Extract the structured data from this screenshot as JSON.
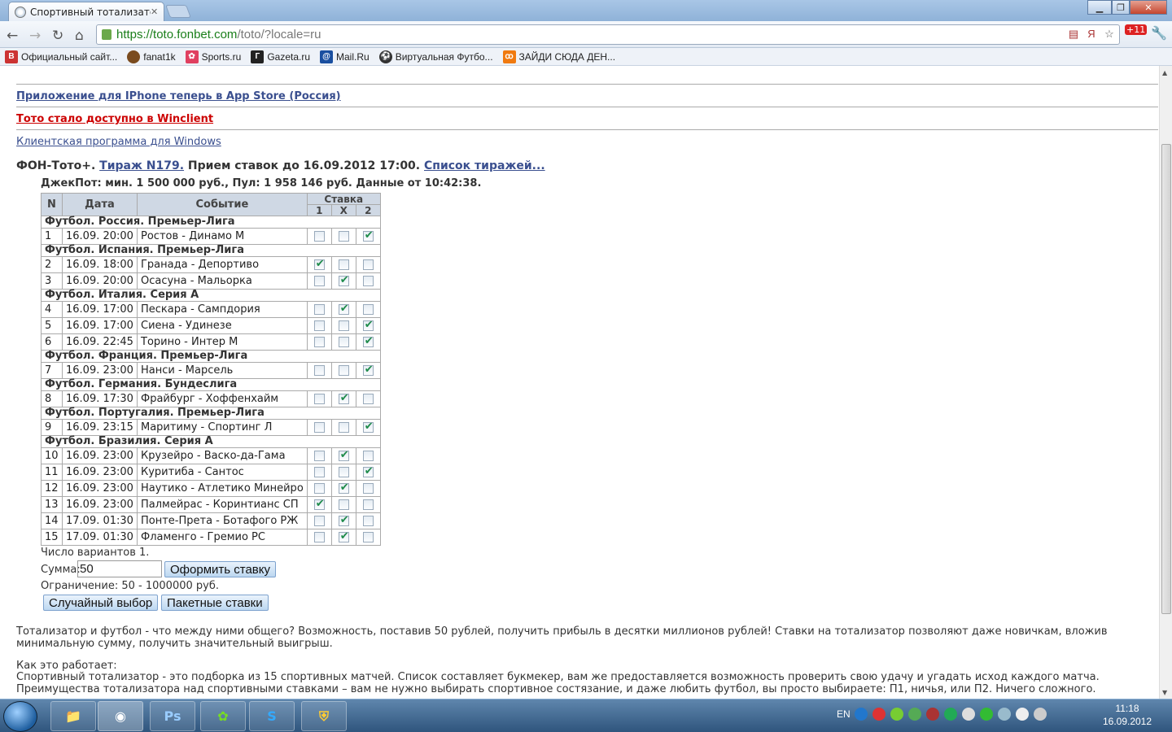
{
  "browser": {
    "tab_title": "Спортивный тотализатор,",
    "url_scheme": "https://",
    "url_host": "toto.fonbet.com",
    "url_rest": "/toto/?locale=ru",
    "bookmarks": [
      "Официальный сайт...",
      "fanat1k",
      "Sports.ru",
      "Gazeta.ru",
      "Mail.Ru",
      "Виртуальная Футбо...",
      "ЗАЙДИ СЮДА ДЕН..."
    ],
    "badge": "+11"
  },
  "page": {
    "link_iphone": "Приложение для IPhone теперь в App Store (Россия)",
    "link_winclient": "Тото стало доступно в Winclient",
    "link_windows": "Клиентская программа для Windows",
    "heading_prefix": "ФОН-Тото+.",
    "heading_draw_link": "Тираж N179.",
    "heading_mid": "Прием ставок до 16.09.2012 17:00.",
    "heading_list_link": "Список тиражей...",
    "jackpot": "ДжекПот: мин. 1 500 000 руб., Пул: 1 958 146 руб. Данные от 10:42:38.",
    "columns": {
      "n": "N",
      "date": "Дата",
      "event": "Событие",
      "stake": "Ставка",
      "o1": "1",
      "ox": "X",
      "o2": "2"
    },
    "groups": [
      {
        "name": "Футбол. Россия. Премьер-Лига",
        "rows": [
          {
            "n": "1",
            "date": "16.09. 20:00",
            "event": "Ростов - Динамо М",
            "pick": 2
          }
        ]
      },
      {
        "name": "Футбол. Испания. Премьер-Лига",
        "rows": [
          {
            "n": "2",
            "date": "16.09. 18:00",
            "event": "Гранада - Депортиво",
            "pick": 0
          },
          {
            "n": "3",
            "date": "16.09. 20:00",
            "event": "Осасуна - Мальорка",
            "pick": 1
          }
        ]
      },
      {
        "name": "Футбол. Италия. Серия А",
        "rows": [
          {
            "n": "4",
            "date": "16.09. 17:00",
            "event": "Пескара - Сампдория",
            "pick": 1
          },
          {
            "n": "5",
            "date": "16.09. 17:00",
            "event": "Сиена - Удинезе",
            "pick": 2
          },
          {
            "n": "6",
            "date": "16.09. 22:45",
            "event": "Торино - Интер М",
            "pick": 2
          }
        ]
      },
      {
        "name": "Футбол. Франция. Премьер-Лига",
        "rows": [
          {
            "n": "7",
            "date": "16.09. 23:00",
            "event": "Нанси - Марсель",
            "pick": 2
          }
        ]
      },
      {
        "name": "Футбол. Германия. Бундеслига",
        "rows": [
          {
            "n": "8",
            "date": "16.09. 17:30",
            "event": "Фрайбург - Хоффенхайм",
            "pick": 1
          }
        ]
      },
      {
        "name": "Футбол. Португалия. Премьер-Лига",
        "rows": [
          {
            "n": "9",
            "date": "16.09. 23:15",
            "event": "Маритиму - Спортинг Л",
            "pick": 2
          }
        ]
      },
      {
        "name": "Футбол. Бразилия. Серия А",
        "rows": [
          {
            "n": "10",
            "date": "16.09. 23:00",
            "event": "Крузейро - Васко-да-Гама",
            "pick": 1
          },
          {
            "n": "11",
            "date": "16.09. 23:00",
            "event": "Куритиба - Сантос",
            "pick": 2
          },
          {
            "n": "12",
            "date": "16.09. 23:00",
            "event": "Наутико - Атлетико Минейро",
            "pick": 1
          },
          {
            "n": "13",
            "date": "16.09. 23:00",
            "event": "Палмейрас - Коринтианс СП",
            "pick": 0
          },
          {
            "n": "14",
            "date": "17.09. 01:30",
            "event": "Понте-Прета - Ботафого РЖ",
            "pick": 1
          },
          {
            "n": "15",
            "date": "17.09. 01:30",
            "event": "Фламенго - Гремио РС",
            "pick": 1
          }
        ]
      }
    ],
    "variants": "Число вариантов 1.",
    "sum_label": "Сумма:",
    "sum_value": "50",
    "submit_label": "Оформить ставку",
    "limit": "Ограничение: 50 - 1000000 руб.",
    "random_label": "Случайный выбор",
    "packet_label": "Пакетные ставки",
    "para1": "Тотализатор и футбол - что между ними общего? Возможность, поставив 50 рублей, получить прибыль в десятки миллионов рублей! Ставки на тотализатор позволяют даже новичкам, вложив минимальную сумму, получить значительный выигрыш.",
    "para2_title": "Как это работает:",
    "para2": "Спортивный тотализатор - это подборка из 15 спортивных матчей. Список составляет букмекер, вам же предоставляется возможность проверить свою удачу и угадать исход каждого матча. Преимущества тотализатора над спортивными ставками – вам не нужно выбирать спортивное состязание, и даже любить футбол, вы просто выбираете: П1, ничья, или П2. Ничего сложного."
  },
  "taskbar": {
    "lang": "EN",
    "time": "11:18",
    "date": "16.09.2012",
    "apps": [
      "Explorer",
      "Chrome",
      "Ps",
      "ICQ",
      "Skype",
      "Security"
    ]
  },
  "colors": {
    "link_blue": "#3a4f8f",
    "link_red": "#cc0000",
    "check_green": "#1e8b4a",
    "header_bg": "#cfd8e4"
  }
}
